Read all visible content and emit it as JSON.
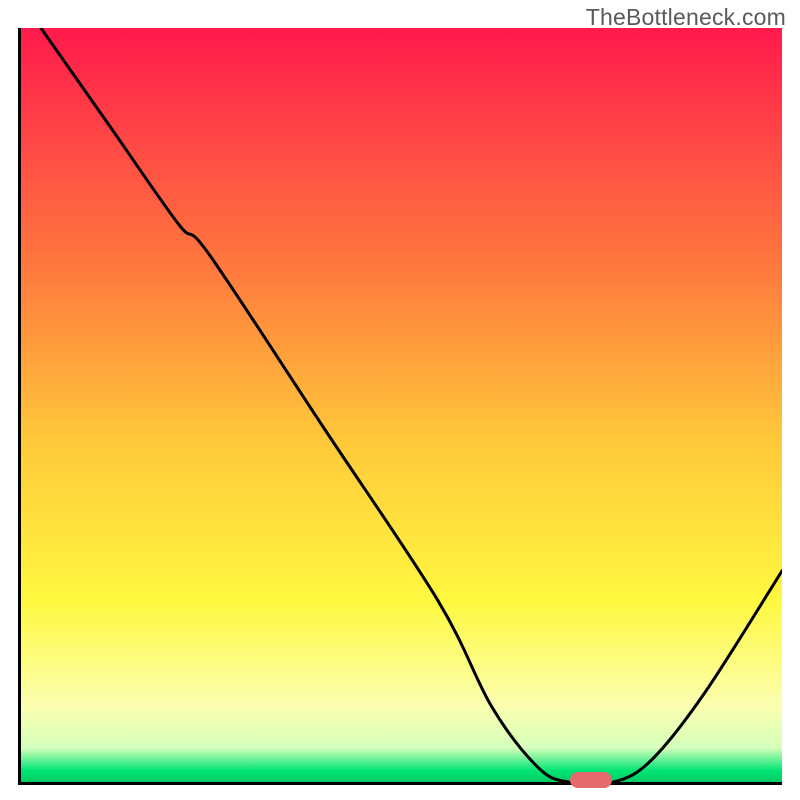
{
  "watermark": "TheBottleneck.com",
  "chart_data": {
    "type": "line",
    "title": "",
    "xlabel": "",
    "ylabel": "",
    "xlim": [
      0,
      100
    ],
    "ylim": [
      0,
      100
    ],
    "grid": false,
    "legend": false,
    "background": {
      "type": "vertical-gradient",
      "stops": [
        {
          "pos": 0.0,
          "color": "#ff1a4c"
        },
        {
          "pos": 0.32,
          "color": "#ff7a3e"
        },
        {
          "pos": 0.55,
          "color": "#ffc93a"
        },
        {
          "pos": 0.76,
          "color": "#fff840"
        },
        {
          "pos": 0.9,
          "color": "#fbffb0"
        },
        {
          "pos": 0.955,
          "color": "#d4ffba"
        },
        {
          "pos": 0.985,
          "color": "#00e574"
        },
        {
          "pos": 1.0,
          "color": "#00cc66"
        }
      ]
    },
    "series": [
      {
        "name": "curve",
        "x": [
          3,
          12,
          21,
          25,
          40,
          55,
          62,
          68,
          72,
          78,
          83,
          90,
          100
        ],
        "y": [
          100,
          87,
          74,
          70,
          47,
          24,
          10,
          2,
          0,
          0,
          3,
          12,
          28
        ]
      }
    ],
    "marker": {
      "x_center": 75,
      "y": 0,
      "width_frac": 0.055,
      "color": "#e66a6c"
    }
  }
}
